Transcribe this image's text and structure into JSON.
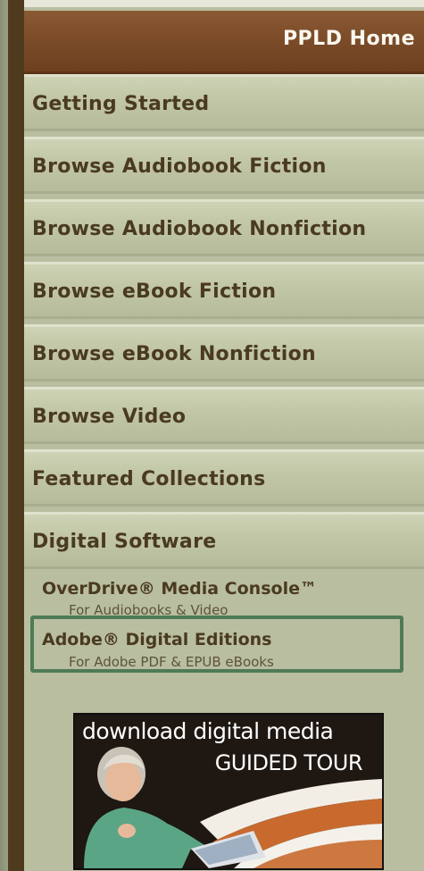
{
  "header": {
    "home_label": "PPLD Home"
  },
  "nav": [
    {
      "label": "Getting Started"
    },
    {
      "label": "Browse Audiobook Fiction"
    },
    {
      "label": "Browse Audiobook Nonfiction"
    },
    {
      "label": "Browse eBook Fiction"
    },
    {
      "label": "Browse eBook Nonfiction"
    },
    {
      "label": "Browse Video"
    },
    {
      "label": "Featured Collections"
    },
    {
      "label": "Digital Software"
    }
  ],
  "software": [
    {
      "title": "OverDrive® Media Console™",
      "desc": "For Audiobooks & Video"
    },
    {
      "title": "Adobe® Digital Editions",
      "desc": "For Adobe PDF & EPUB eBooks"
    }
  ],
  "tour_banner": {
    "line1": "download digital media",
    "line2": "GUIDED TOUR"
  },
  "colors": {
    "sidebar_bg": "#b9bea0",
    "home_bar": "#7b4b28",
    "nav_text": "#4a3a22",
    "highlight": "#4f7a56",
    "left_bar": "#4e3a1c"
  }
}
